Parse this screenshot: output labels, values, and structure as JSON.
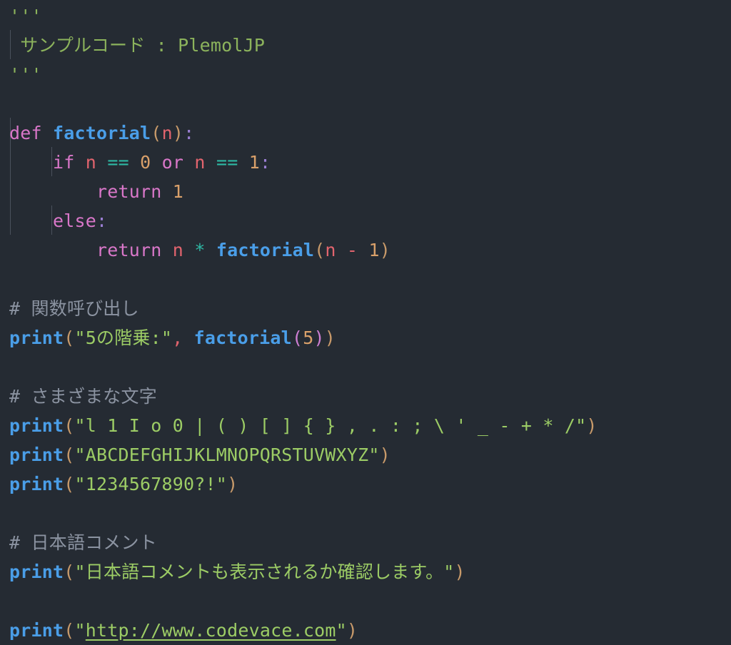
{
  "editor": {
    "language": "python",
    "background": "#252b33",
    "font_sample_name": "PlemolJP",
    "indent_guide_color": "#4a515c"
  },
  "palette": {
    "docstring": "#8cb35c",
    "string": "#9ccc65",
    "comment": "#8b93a1",
    "keyword": "#d977c9",
    "function": "#4a9ee8",
    "variable": "#e2646e",
    "number": "#d9a06a",
    "operator": "#2eb8a4",
    "colon": "#9b7fd4",
    "paren_level_1": "#c89a6a",
    "paren_level_2": "#cf7fd4"
  },
  "code": {
    "docstring_open": "'''",
    "docstring_text": " サンプルコード : PlemolJP",
    "docstring_close": "'''",
    "def_keyword": "def",
    "def_space": " ",
    "def_name": "factorial",
    "def_paren_open": "(",
    "def_arg": "n",
    "def_paren_close": ")",
    "def_colon": ":",
    "if_indent": "    ",
    "if_keyword": "if",
    "if_var1": "n",
    "if_eq1": "==",
    "if_num0": "0",
    "if_or": "or",
    "if_var2": "n",
    "if_eq2": "==",
    "if_num1": "1",
    "if_colon": ":",
    "ret1_indent": "        ",
    "ret1_keyword": "return",
    "ret1_value": "1",
    "else_indent": "    ",
    "else_keyword": "else",
    "else_colon": ":",
    "ret2_indent": "        ",
    "ret2_keyword": "return",
    "ret2_var": "n",
    "ret2_star": "*",
    "ret2_func": "factorial",
    "ret2_paren_open": "(",
    "ret2_arg": "n",
    "ret2_minus": "-",
    "ret2_num": "1",
    "ret2_paren_close": ")",
    "comment_call": "# 関数呼び出し",
    "print_call_name": "print",
    "print_call_paren_open": "(",
    "print_call_string": "\"5の階乗:\"",
    "print_call_comma": ",",
    "print_call_func": "factorial",
    "print_call_inner_open": "(",
    "print_call_arg": "5",
    "print_call_inner_close": ")",
    "print_call_paren_close": ")",
    "comment_chars": "# さまざまな文字",
    "print_chars_name": "print",
    "print_chars_paren_open": "(",
    "print_chars_string": "\"l 1 I o 0 | ( ) [ ] { } , . : ; \\ ' _ - + * /\"",
    "print_chars_paren_close": ")",
    "print_alpha_name": "print",
    "print_alpha_paren_open": "(",
    "print_alpha_string": "\"ABCDEFGHIJKLMNOPQRSTUVWXYZ\"",
    "print_alpha_paren_close": ")",
    "print_num_name": "print",
    "print_num_paren_open": "(",
    "print_num_string": "\"1234567890?!\"",
    "print_num_paren_close": ")",
    "comment_japanese": "# 日本語コメント",
    "print_jp_name": "print",
    "print_jp_paren_open": "(",
    "print_jp_string": "\"日本語コメントも表示されるか確認します。\"",
    "print_jp_paren_close": ")",
    "print_url_name": "print",
    "print_url_paren_open": "(",
    "print_url_quote_open": "\"",
    "print_url_link": "http://www.codevace.com",
    "print_url_quote_close": "\"",
    "print_url_paren_close": ")"
  }
}
